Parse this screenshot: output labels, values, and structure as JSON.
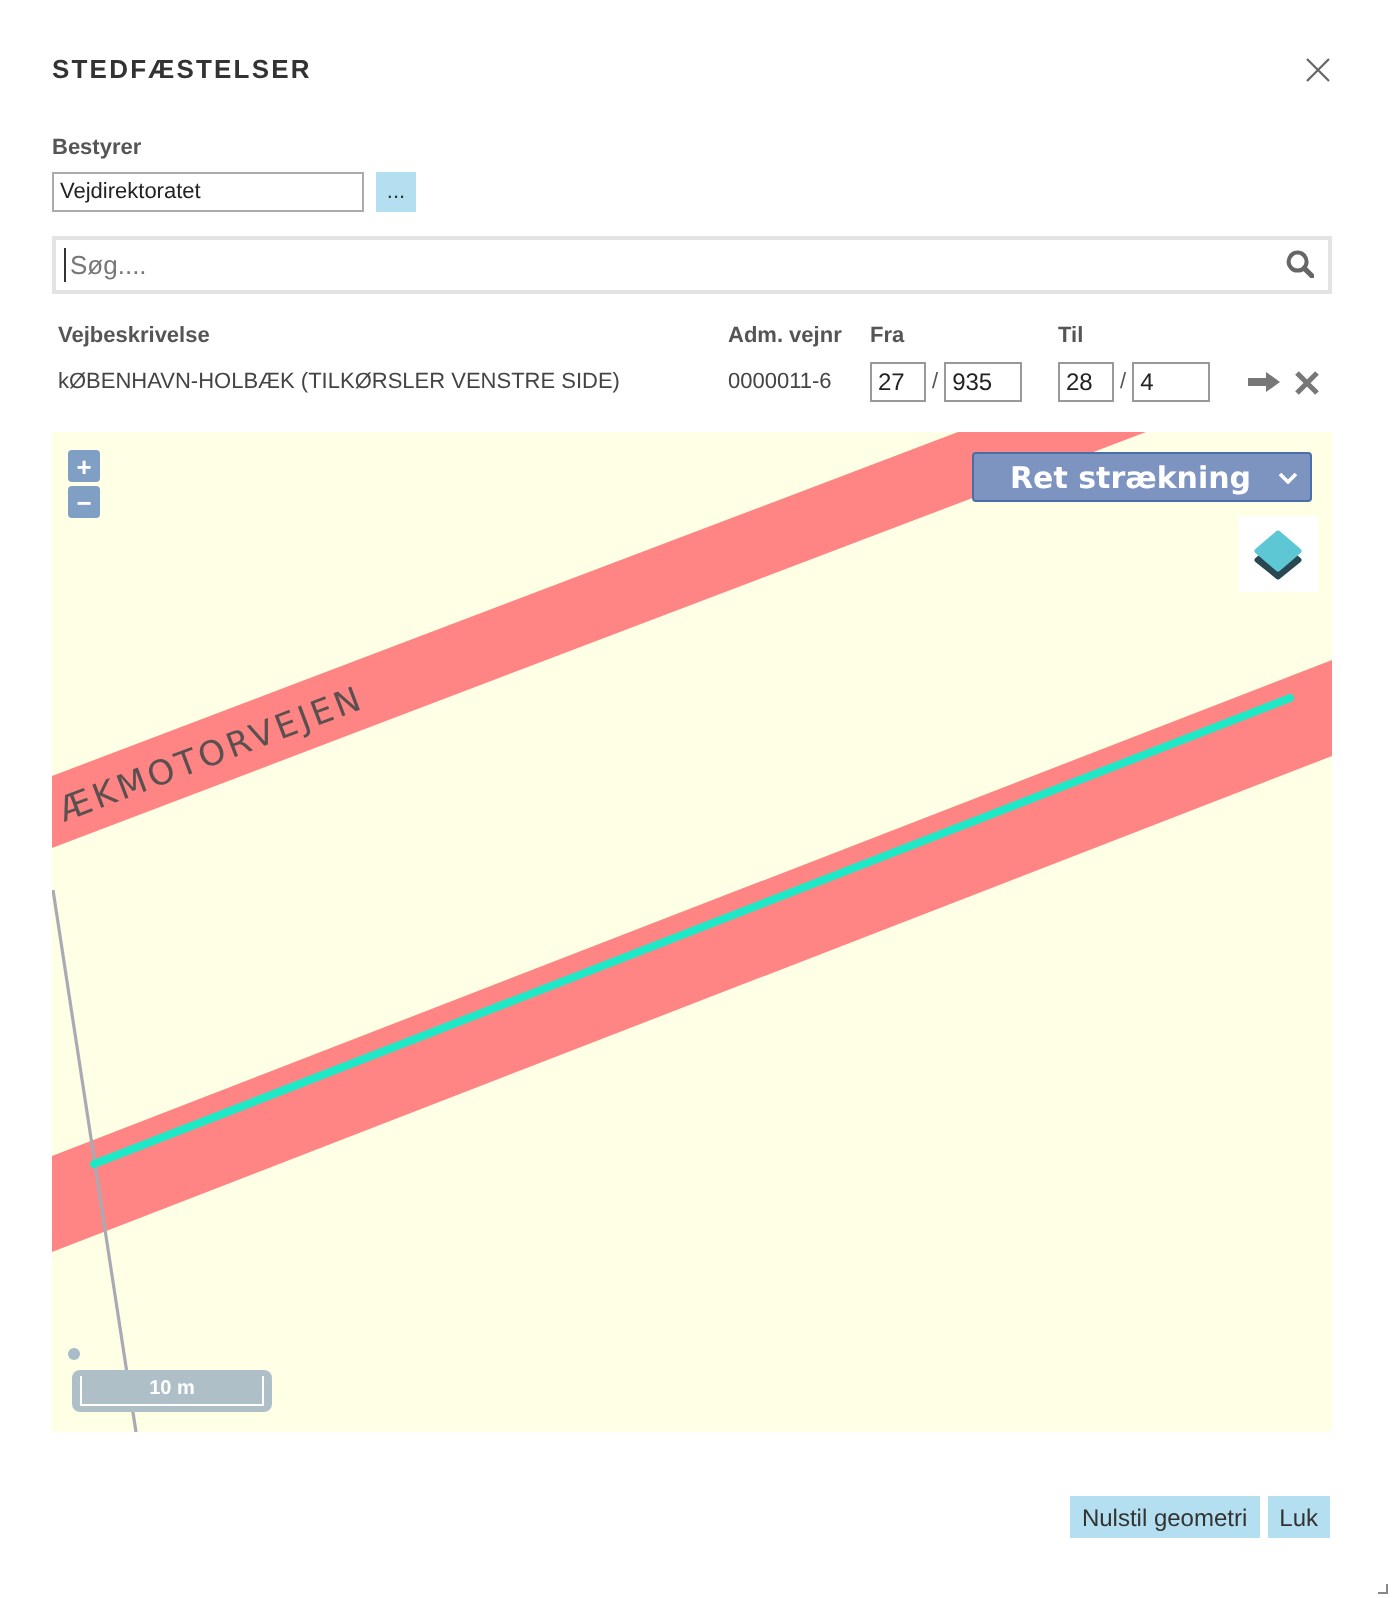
{
  "dialog": {
    "title": "STEDFÆSTELSER"
  },
  "manager": {
    "label": "Bestyrer",
    "value": "Vejdirektoratet",
    "button": "..."
  },
  "search": {
    "placeholder": "Søg...."
  },
  "table": {
    "columns": [
      "Vejbeskrivelse",
      "Adm. vejnr",
      "Fra",
      "Til"
    ],
    "rows": [
      {
        "description": "kØBENHAVN-HOLBÆK (TILKØRSLER VENSTRE SIDE)",
        "road_number": "0000011-6",
        "from": {
          "value_1": "27",
          "separator": "/",
          "value_2": "935"
        },
        "to": {
          "value_1": "28",
          "separator": "/",
          "value_2": "4"
        }
      }
    ]
  },
  "map": {
    "zoom_in": "+",
    "zoom_out": "−",
    "mode_select": "Ret strækning",
    "road_label": "ÆKMOTORVEJEN",
    "scale": "10 m"
  },
  "buttons": [
    "Nulstil geometri",
    "Luk"
  ]
}
